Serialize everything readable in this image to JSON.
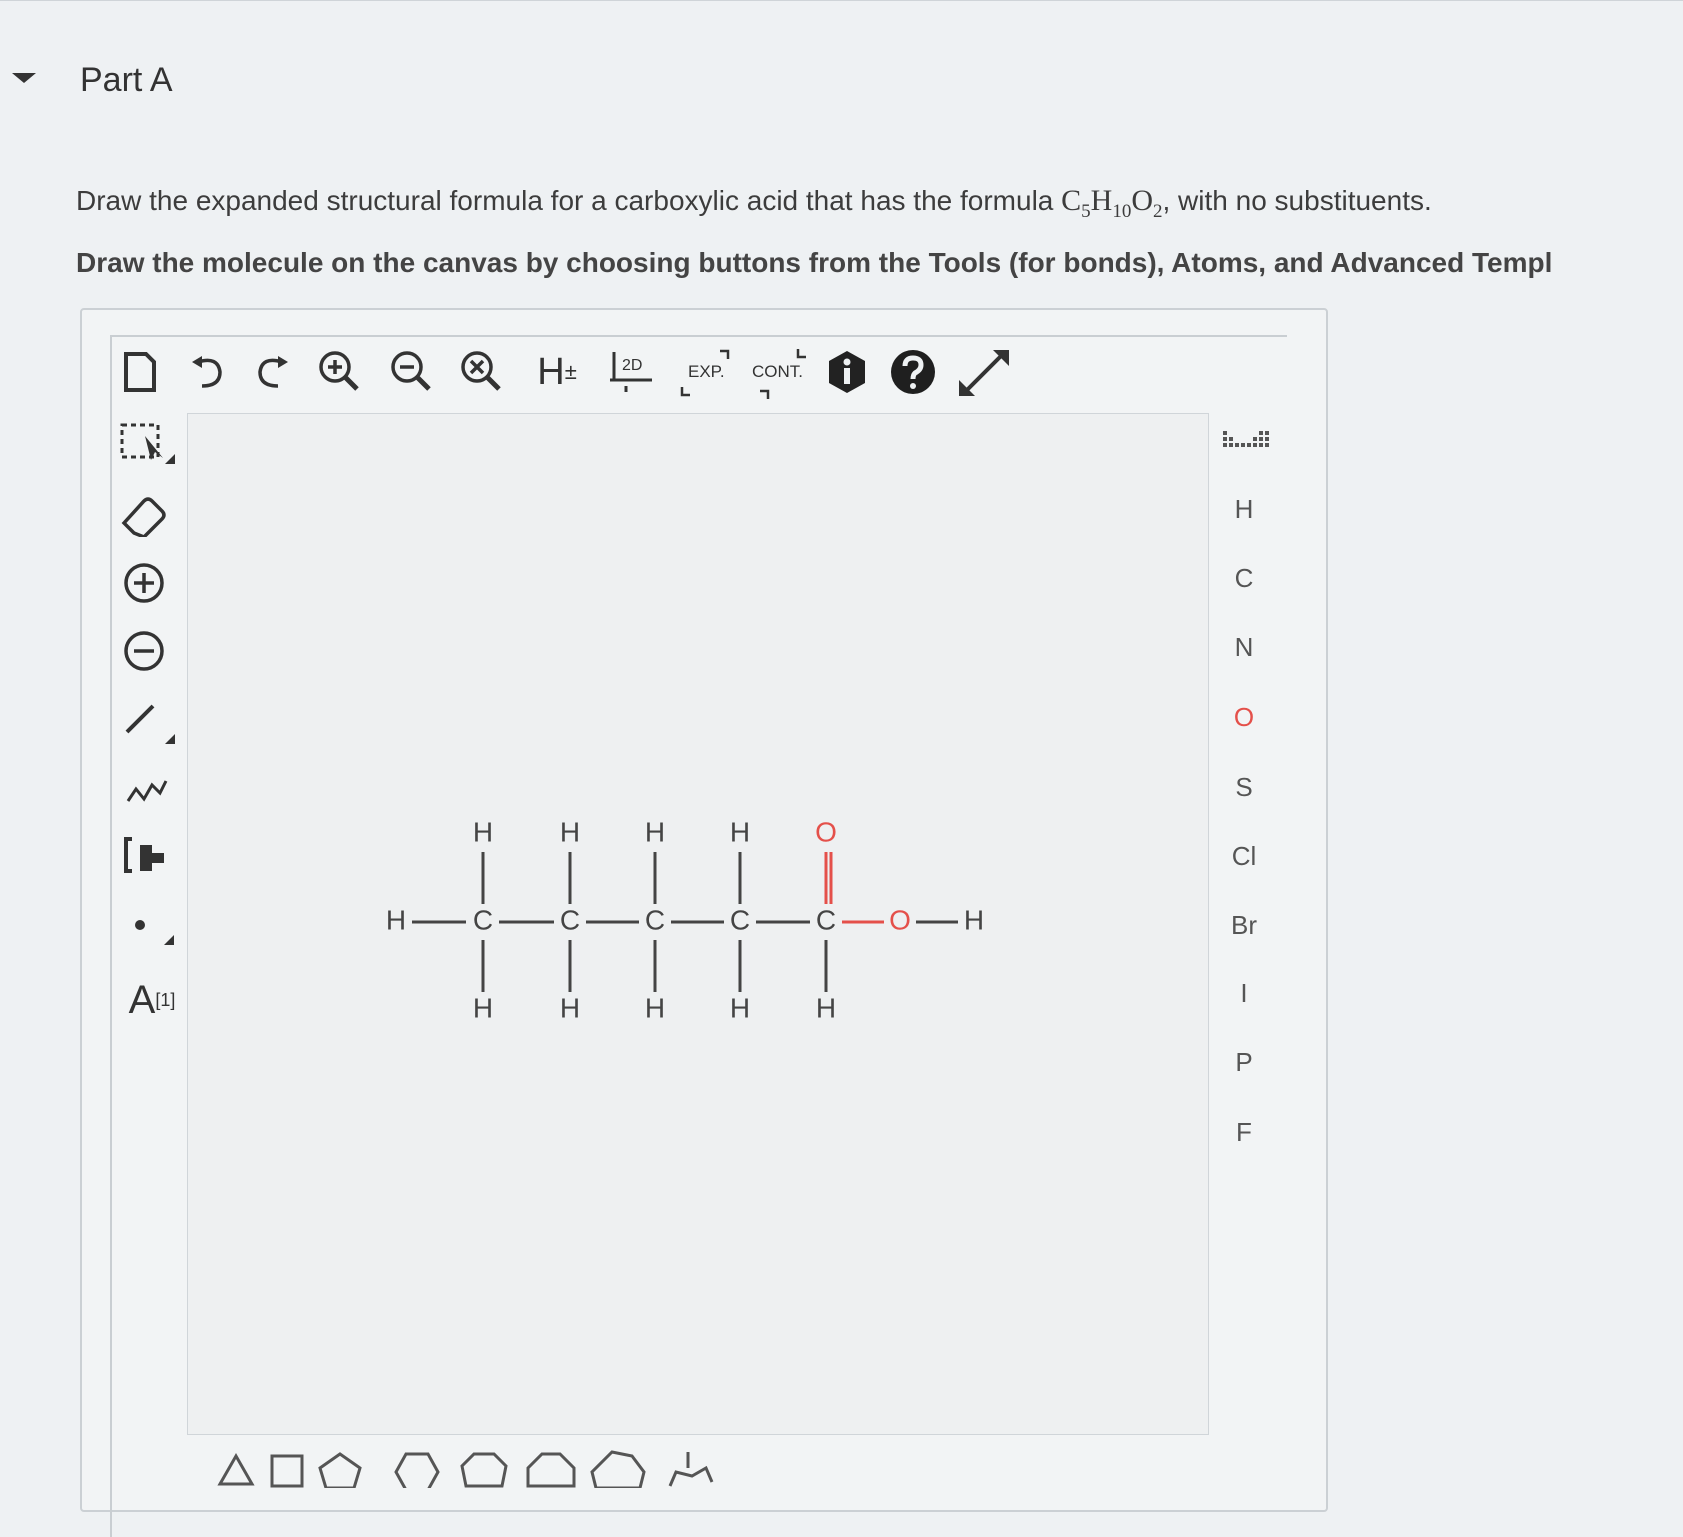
{
  "part": {
    "title": "Part A"
  },
  "question": {
    "text_before": "Draw the expanded structural formula for a carboxylic acid that has the formula ",
    "formula_c": "C",
    "formula_c_sub": "5",
    "formula_h": "H",
    "formula_h_sub": "10",
    "formula_o": "O",
    "formula_o_sub": "2",
    "text_after": ", with no substituents."
  },
  "instruction": "Draw the molecule on the canvas by choosing buttons from the Tools (for bonds), Atoms, and Advanced Templ",
  "toolbar": {
    "h_toggle": "H",
    "h_toggle_sup": "±",
    "label_2d": "2D",
    "label_exp": "EXP.",
    "label_cont": "CONT.",
    "icons": [
      "new-document-icon",
      "undo-icon",
      "redo-icon",
      "zoom-in-icon",
      "zoom-out-icon",
      "zoom-reset-icon",
      "explicit-hydrogens-icon",
      "clean-2d-icon",
      "expand-icon",
      "contract-icon",
      "info-icon",
      "help-icon",
      "fullscreen-icon"
    ]
  },
  "left_tools": {
    "charge_label": "A",
    "charge_sup": "[1]",
    "icons": [
      "select-icon",
      "eraser-icon",
      "positive-charge-icon",
      "negative-charge-icon",
      "single-bond-icon",
      "chain-icon",
      "bracket-icon",
      "radical-icon",
      "atom-label-icon"
    ]
  },
  "atoms": {
    "periodic_label": "periodic-table-icon",
    "list": [
      "H",
      "C",
      "N",
      "O",
      "S",
      "Cl",
      "Br",
      "I",
      "P",
      "F"
    ]
  },
  "molecule": {
    "atoms_top": [
      "H",
      "H",
      "H",
      "H",
      "O"
    ],
    "atoms_bottom": [
      "H",
      "H",
      "H",
      "H",
      "H"
    ],
    "chain_left": "H",
    "chain_carbons": [
      "C",
      "C",
      "C",
      "C",
      "C"
    ],
    "oh_oxygen": "O",
    "oh_hydrogen": "H"
  },
  "colors": {
    "oxygen": "#e4504a",
    "text": "#444444",
    "help": "#1f1f1f"
  },
  "templates": [
    "triangle",
    "square",
    "pentagon",
    "hexagon",
    "heptagon",
    "octagon",
    "nonagon",
    "chair"
  ]
}
